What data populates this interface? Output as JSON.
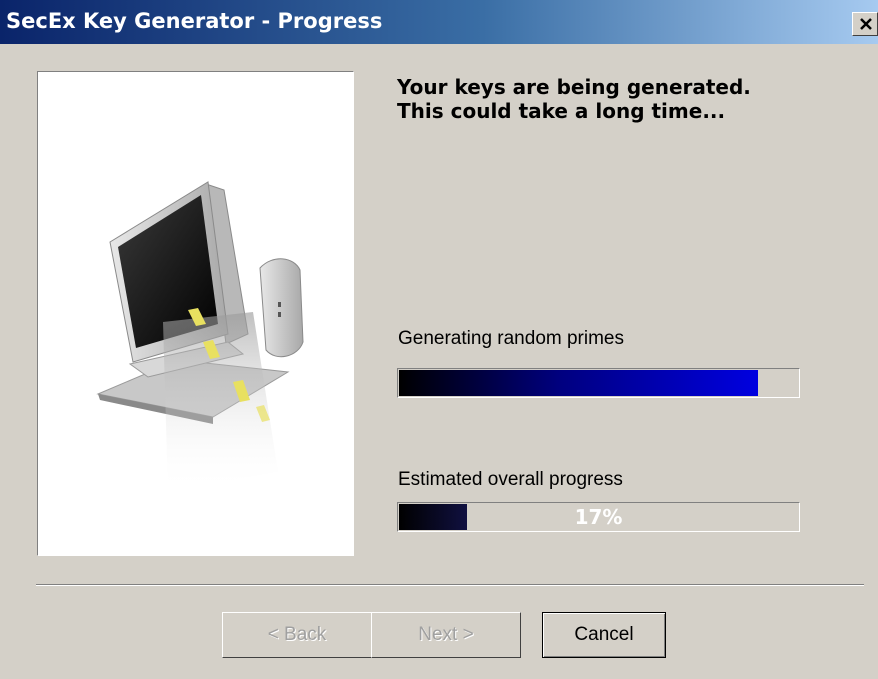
{
  "window": {
    "title": "SecEx Key Generator - Progress"
  },
  "header": {
    "line1": "Your keys are being generated.",
    "line2": "This could take a long time..."
  },
  "primes": {
    "label": "Generating random primes",
    "progress": 0.9
  },
  "overall": {
    "label": "Estimated overall progress",
    "percent_text": "17%",
    "progress": 0.17
  },
  "buttons": {
    "back": "< Back",
    "next": "Next >",
    "cancel": "Cancel"
  },
  "icons": {
    "close": "close-icon",
    "illustration": "computer-illustration"
  }
}
